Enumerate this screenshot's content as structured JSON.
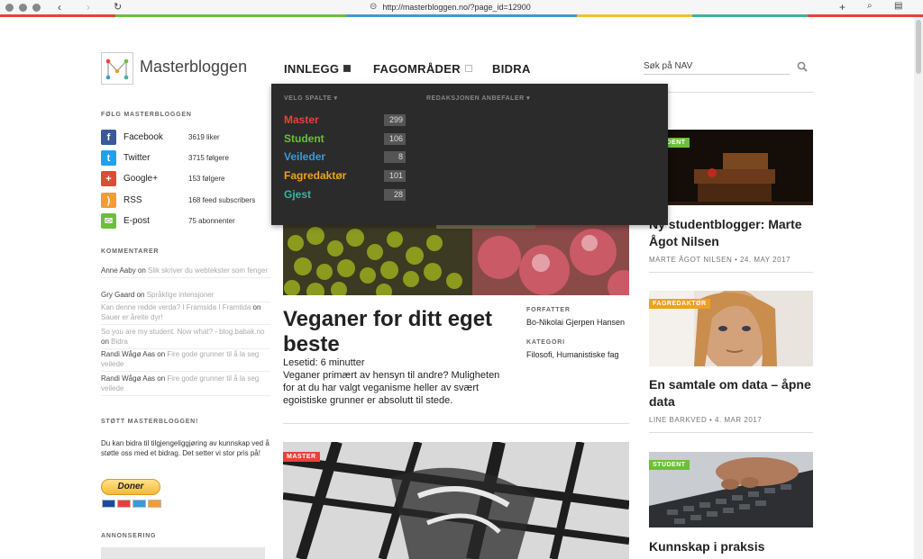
{
  "browser": {
    "url": "http://masterbloggen.no/?page_id=12900",
    "colorbar": [
      "#e8413a",
      "#6bbf3a",
      "#3a9ad9",
      "#f0c030",
      "#3bb49c",
      "#e8413a"
    ]
  },
  "site": {
    "title": "Masterbloggen"
  },
  "nav": {
    "innlegg": "INNLEGG",
    "fagomrader": "FAGOMRÅDER",
    "bidra": "BIDRA"
  },
  "search": {
    "placeholder": "Søk på NAV"
  },
  "dropdown": {
    "col1_head": "VELG SPALTE",
    "col2_head": "REDAKSJONEN ANBEFALER",
    "items": [
      {
        "label": "Master",
        "count": "299",
        "color": "#e8413a"
      },
      {
        "label": "Student",
        "count": "106",
        "color": "#6bbf3a"
      },
      {
        "label": "Veileder",
        "count": "8",
        "color": "#3a9ad9"
      },
      {
        "label": "Fagredaktør",
        "count": "101",
        "color": "#f0a020"
      },
      {
        "label": "Gjest",
        "count": "28",
        "color": "#3bb49c"
      }
    ]
  },
  "sidebar": {
    "follow_head": "FØLG MASTERBLOGGEN",
    "social": [
      {
        "name": "Facebook",
        "count": "3619 liker",
        "icon": "facebook-icon",
        "color": "#3b5998",
        "glyph": "f"
      },
      {
        "name": "Twitter",
        "count": "3715 følgere",
        "icon": "twitter-icon",
        "color": "#1da1f2",
        "glyph": "t"
      },
      {
        "name": "Google+",
        "count": "153 følgere",
        "icon": "google-plus-icon",
        "color": "#dd4b39",
        "glyph": "+"
      },
      {
        "name": "RSS",
        "count": "168 feed subscribers",
        "icon": "rss-icon",
        "color": "#f39c32",
        "glyph": ")"
      },
      {
        "name": "E-post",
        "count": "75 abonnenter",
        "icon": "email-icon",
        "color": "#6bbf3a",
        "glyph": "✉"
      }
    ],
    "comments_head": "KOMMENTARER",
    "comments": [
      {
        "author": "Anne Aaby",
        "on": " on ",
        "link": "Slik skriver du webtekster som fenger"
      },
      {
        "author": "Gry Gaard",
        "on": " on ",
        "link": "Språklige intensjoner"
      },
      {
        "author": "Kan denne redde verda? I Framsida I Framtida",
        "on": " on ",
        "link": "Sauer er åreite dyr!"
      },
      {
        "author": "So you are my student. Now what? - blog.babak.no",
        "on": " on ",
        "link": "Bidra"
      },
      {
        "author": "Randi Wågø Aas",
        "on": " on ",
        "link": "Fire gode grunner til å la seg veilede"
      },
      {
        "author": "Randi Wågø Aas",
        "on": " on ",
        "link": "Fire gode grunner til å la seg veilede"
      }
    ],
    "support_head": "STØTT MASTERBLOGGEN!",
    "support_text": "Du kan bidra til tilgjengeliggjøring av kunnskap ved å støtte oss med et bidrag. Det setter vi stor pris på!",
    "donate_label": "Doner",
    "ads_head": "ANNONSERING"
  },
  "feature": {
    "title": "Veganer for ditt eget beste",
    "lesetid": "Lesetid: 6 minutter",
    "excerpt": "Veganer primært av hensyn til andre? Muligheten for at du har valgt veganisme heller av svært egoistiske grunner er absolutt til stede.",
    "author_head": "FORFATTER",
    "author": "Bo-Nikolai Gjerpen Hansen",
    "category_head": "KATEGORI",
    "category": "Filosofi, Humanistiske fag"
  },
  "second": {
    "badge": "MASTER"
  },
  "right": [
    {
      "badge": "STUDENT",
      "badge_color": "#6bbf3a",
      "title": "Ny studentblogger: Marte Ågot Nilsen",
      "meta": "MARTE ÅGOT NILSEN • 24. MAY 2017"
    },
    {
      "badge": "FAGREDAKTØR",
      "badge_color": "#f0a020",
      "title": "En samtale om data – åpne data",
      "meta": "LINE BARKVED • 4. MAR 2017"
    },
    {
      "badge": "STUDENT",
      "badge_color": "#6bbf3a",
      "title": "Kunnskap i praksis",
      "meta": ""
    }
  ]
}
